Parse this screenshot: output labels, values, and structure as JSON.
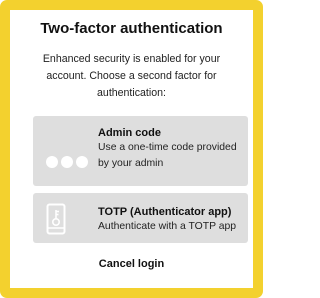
{
  "dialog": {
    "title": "Two-factor authentication",
    "description": "Enhanced security is enabled for your account. Choose a second factor for authentication:",
    "options": [
      {
        "icon": "dots-icon",
        "title": "Admin code",
        "description": "Use a one-time code provided by your admin"
      },
      {
        "icon": "phone-key-icon",
        "title": "TOTP (Authenticator app)",
        "description": "Authenticate with a TOTP app"
      }
    ],
    "cancel_label": "Cancel login"
  },
  "colors": {
    "frame": "#f3d12e",
    "option_bg": "#dedede",
    "text": "#111111"
  }
}
